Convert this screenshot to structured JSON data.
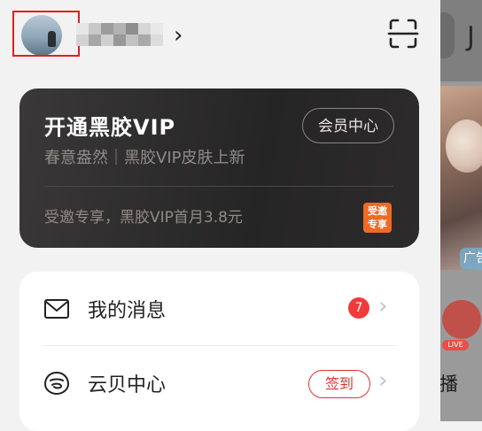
{
  "header": {
    "username_masked": true,
    "chevron": "›",
    "scan_icon": "scan-icon"
  },
  "vip": {
    "title": "开通黑胶VIP",
    "subtitle": "春意盎然｜黑胶VIP皮肤上新",
    "center_button": "会员中心",
    "offer": "受邀专享，黑胶VIP首月3.8元",
    "badge_line1": "受邀",
    "badge_line2": "专享"
  },
  "menu": {
    "messages": {
      "label": "我的消息",
      "count": "7",
      "icon": "mail-icon"
    },
    "yunbei": {
      "label": "云贝中心",
      "action": "签到",
      "icon": "shell-icon"
    }
  },
  "background_app": {
    "letter": "J",
    "ad_label": "广告",
    "live_label": "LIVE",
    "text": "播"
  },
  "colors": {
    "accent": "#e0332f",
    "vip_bg": "#2a2828",
    "badge_orange": "#f06a23"
  }
}
